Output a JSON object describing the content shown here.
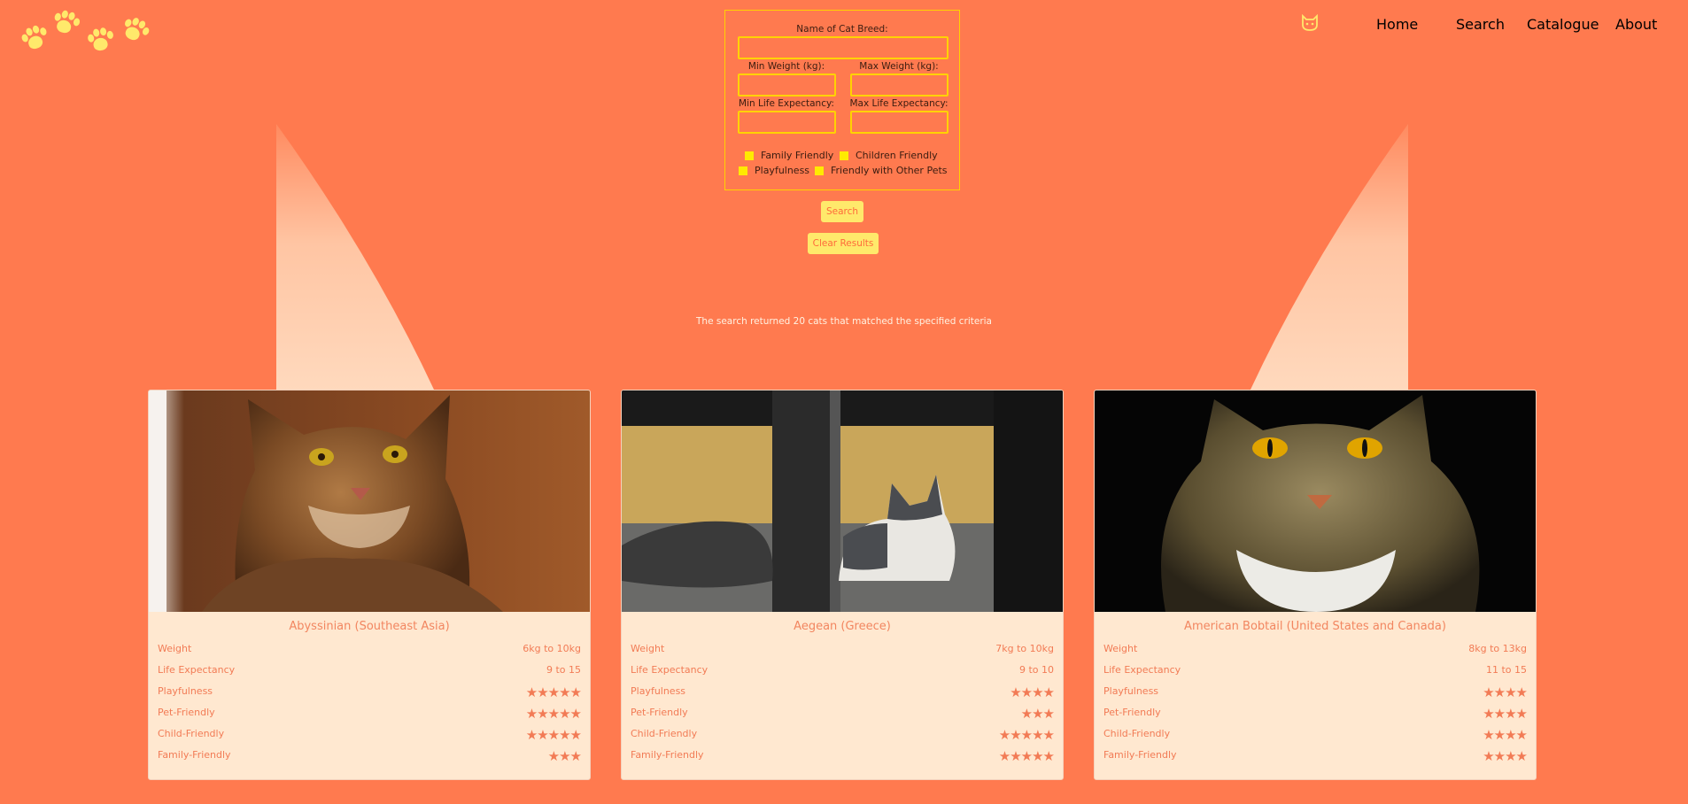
{
  "brand": {
    "logo_icon": "paw-prints-icon"
  },
  "nav": {
    "icon": "cat-face-icon",
    "items": [
      "Home",
      "Search",
      "Catalogue",
      "About"
    ]
  },
  "search_form": {
    "name_label": "Name of Cat Breed:",
    "name_value": "",
    "min_weight_label": "Min Weight (kg):",
    "max_weight_label": "Max Weight (kg):",
    "min_life_label": "Min Life Expectancy:",
    "max_life_label": "Max Life Expectancy:",
    "checkboxes": [
      "Family Friendly",
      "Children Friendly",
      "Playfulness",
      "Friendly with Other Pets"
    ],
    "search_button": "Search",
    "clear_button": "Clear Results"
  },
  "result_message": "The search returned 20 cats that matched the specified criteria",
  "colors": {
    "background": "#ff7a4f",
    "accent": "#ffe96b",
    "card": "#ffe8d0",
    "text": "#f27b55"
  },
  "row_labels": {
    "weight": "Weight",
    "life": "Life Expectancy",
    "play": "Playfulness",
    "pet": "Pet-Friendly",
    "child": "Child-Friendly",
    "family": "Family-Friendly"
  },
  "cards": [
    {
      "title": "Abyssinian (Southeast Asia)",
      "weight": "6kg to 10kg",
      "life": "9 to 15",
      "playfulness": 5,
      "pet_friendly": 5,
      "child_friendly": 5,
      "family_friendly": 3
    },
    {
      "title": "Aegean (Greece)",
      "weight": "7kg to 10kg",
      "life": "9 to 10",
      "playfulness": 4,
      "pet_friendly": 3,
      "child_friendly": 5,
      "family_friendly": 5
    },
    {
      "title": "American Bobtail (United States and Canada)",
      "weight": "8kg to 13kg",
      "life": "11 to 15",
      "playfulness": 4,
      "pet_friendly": 4,
      "child_friendly": 4,
      "family_friendly": 4
    }
  ]
}
